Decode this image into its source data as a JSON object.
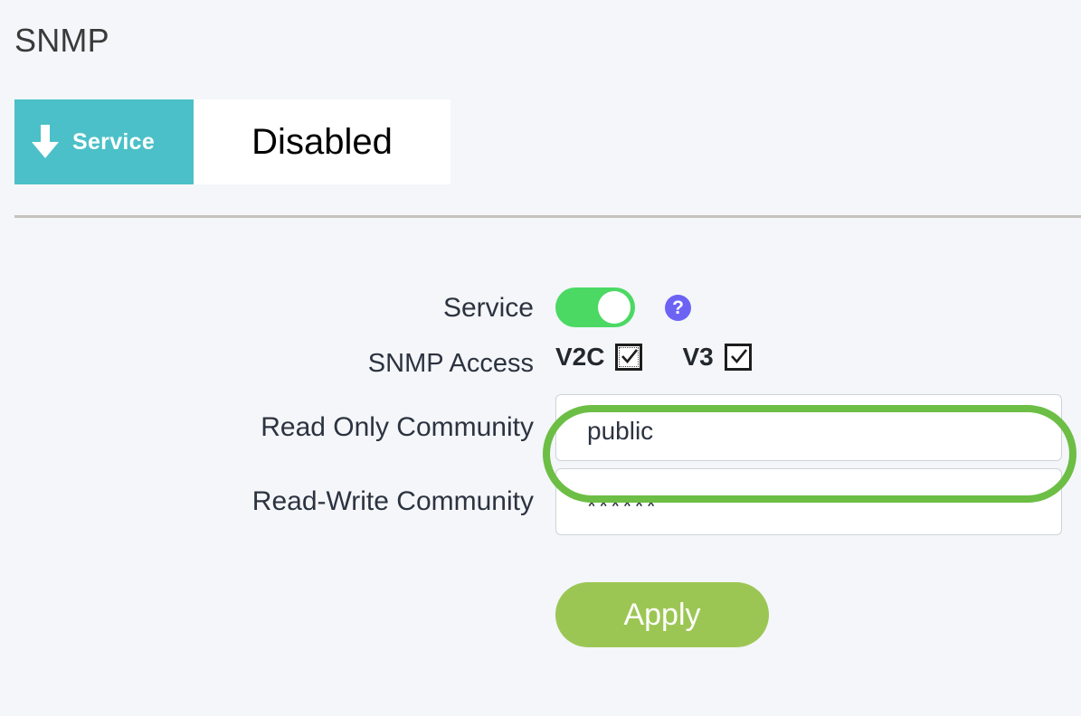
{
  "page": {
    "title": "SNMP"
  },
  "status_strip": {
    "badge_icon": "arrow-down-icon",
    "badge_label": "Service",
    "value": "Disabled"
  },
  "form": {
    "service": {
      "label": "Service",
      "toggle_state": "on",
      "help_icon": "question-mark-icon",
      "help_label": "?"
    },
    "snmp_access": {
      "label": "SNMP Access",
      "options": [
        {
          "name": "V2C",
          "checked": true,
          "focused": true
        },
        {
          "name": "V3",
          "checked": true,
          "focused": false
        }
      ]
    },
    "read_only_community": {
      "label": "Read Only Community",
      "value": "public",
      "placeholder": ""
    },
    "read_write_community": {
      "label": "Read-Write Community",
      "value": "******",
      "placeholder": ""
    },
    "apply_label": "Apply"
  },
  "colors": {
    "page_background": "#f4f6f9",
    "badge_teal": "#4bc0c8",
    "toggle_green": "#4bd964",
    "help_purple": "#6c63f5",
    "apply_green": "#9cc654",
    "annotation_green": "#6cbe45",
    "divider_gray": "#c6c2be",
    "label_text": "#2c3340"
  }
}
